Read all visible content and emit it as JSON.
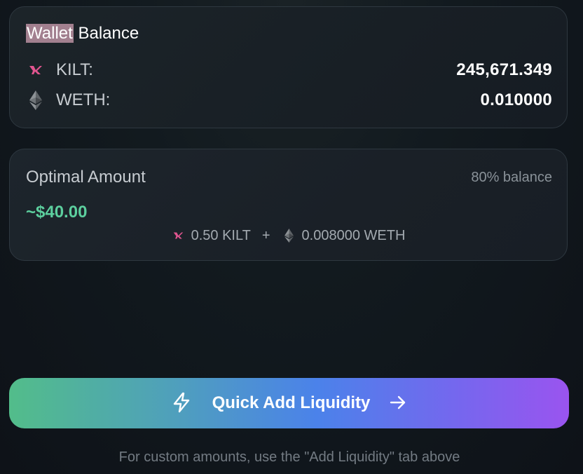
{
  "wallet": {
    "title_highlighted": "Wallet",
    "title_rest": "Balance",
    "tokens": [
      {
        "icon": "kilt-logo-icon",
        "label": "KILT:",
        "value": "245,671.349"
      },
      {
        "icon": "ethereum-logo-icon",
        "label": "WETH:",
        "value": "0.010000"
      }
    ]
  },
  "optimal": {
    "title": "Optimal Amount",
    "note": "80% balance",
    "usd_value": "~$40.00",
    "kilt_amount": "0.50 KILT",
    "plus": "+",
    "weth_amount": "0.008000 WETH"
  },
  "cta": {
    "label": "Quick Add Liquidity",
    "leading_icon": "lightning-bolt-icon",
    "trailing_icon": "arrow-right-icon"
  },
  "footer": {
    "hint": "For custom amounts, use the \"Add Liquidity\" tab above"
  },
  "colors": {
    "kilt_accent": "#e0558f",
    "usd_green": "#5ccf9e",
    "gradient_start": "#52bd8a",
    "gradient_mid": "#4b82ea",
    "gradient_end": "#9a54ef"
  }
}
